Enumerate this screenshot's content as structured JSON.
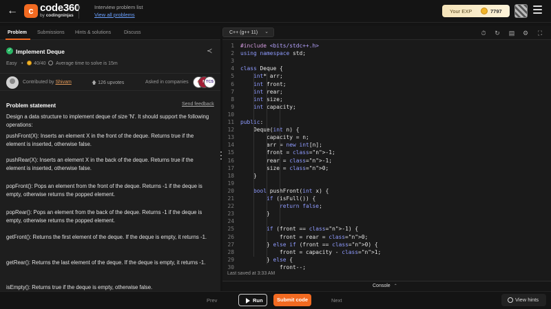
{
  "header": {
    "brand": "code",
    "brand_num": "360",
    "brand_by": "by",
    "brand_org": "codingninjas",
    "logo_glyph": "c",
    "crumb_primary": "Interview problem list",
    "crumb_link": "View all problems",
    "exp_label": "Your EXP",
    "exp_value": "7797"
  },
  "tabs": [
    {
      "label": "Problem"
    },
    {
      "label": "Submissions"
    },
    {
      "label": "Hints & solutions"
    },
    {
      "label": "Discuss"
    }
  ],
  "problem": {
    "title": "Implement Deque",
    "difficulty": "Easy",
    "score": "40/40",
    "avg_time": "Average time to solve is 15m",
    "contributed_by_label": "Contributed by",
    "contributor": "Shivam",
    "upvotes": "126 upvotes",
    "asked_in": "Asked in companies",
    "companies": [
      {
        "abbr": "A",
        "color": "#e8312f",
        "bg": "#ffffff"
      },
      {
        "abbr": "M",
        "color": "#ffffff",
        "bg": "#a31e36"
      },
      {
        "abbr": "TCS",
        "color": "#4b2a8c",
        "bg": "#ffffff"
      }
    ],
    "statement_heading": "Problem statement",
    "send_feedback": "Send feedback",
    "paragraphs": [
      "Design a data structure to implement deque of size 'N'. It should support the following operations:",
      "pushFront(X): Inserts an element X in the front of the deque. Returns true if the element is inserted, otherwise false.",
      "pushRear(X): Inserts an element X in the back of the deque. Returns true if the element is inserted, otherwise false.",
      "popFront(): Pops an element from the front of the deque. Returns -1 if the deque is empty, otherwise returns the popped element.",
      "popRear(): Pops an element from the back of the deque. Returns -1 if the deque is empty, otherwise returns the popped element.",
      "getFront(): Returns the first element of the deque. If the deque is empty, it returns -1.",
      "getRear(): Returns the last element of the deque. If the deque is empty, it returns -1.",
      "isEmpty(): Returns true if the deque is empty, otherwise false."
    ]
  },
  "editor": {
    "language": "C++ (g++ 11)",
    "last_saved": "Last saved at 3:33 AM",
    "console_label": "Console",
    "lines": [
      "#include <bits/stdc++.h>",
      "using namespace std;",
      "",
      "class Deque {",
      "    int* arr;",
      "    int front;",
      "    int rear;",
      "    int size;",
      "    int capacity;",
      "",
      "public:",
      "    Deque(int n) {",
      "        capacity = n;",
      "        arr = new int[n];",
      "        front = -1;",
      "        rear = -1;",
      "        size = 0;",
      "    }",
      "",
      "    bool pushFront(int x) {",
      "        if (isFull()) {",
      "            return false;",
      "        }",
      "",
      "        if (front == -1) {",
      "            front = rear = 0;",
      "        } else if (front == 0) {",
      "            front = capacity - 1;",
      "        } else {",
      "            front--;"
    ]
  },
  "footer": {
    "prev": "Prev",
    "run": "Run",
    "submit": "Submit code",
    "next": "Next",
    "hints": "View hints"
  },
  "colors": {
    "accent": "#f26a21",
    "success": "#2ab665",
    "link": "#6aa0ff"
  }
}
